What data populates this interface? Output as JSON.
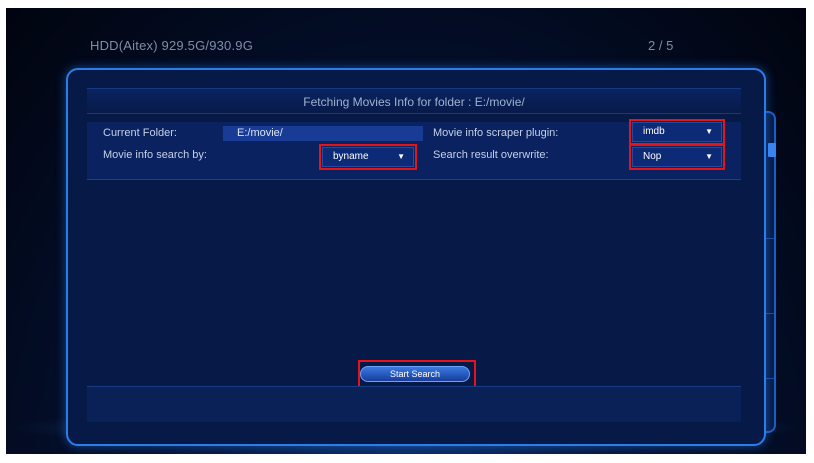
{
  "header": {
    "hdd_info": "HDD(Aitex) 929.5G/930.9G",
    "page_counter": "2 / 5"
  },
  "dialog": {
    "title": "Fetching Movies Info for folder : E:/movie/",
    "current_folder_label": "Current Folder:",
    "current_folder_value": "E:/movie/",
    "search_by_label": "Movie info search by:",
    "search_by_value": "byname",
    "scraper_label": "Movie info scraper plugin:",
    "scraper_value": "imdb",
    "overwrite_label": "Search result overwrite:",
    "overwrite_value": "Nop",
    "start_button_label": "Start Search"
  },
  "colors": {
    "accent": "#2c7de6",
    "highlight_outline": "#e5141b"
  },
  "icons": {
    "dropdown": "chevron-down-icon"
  }
}
